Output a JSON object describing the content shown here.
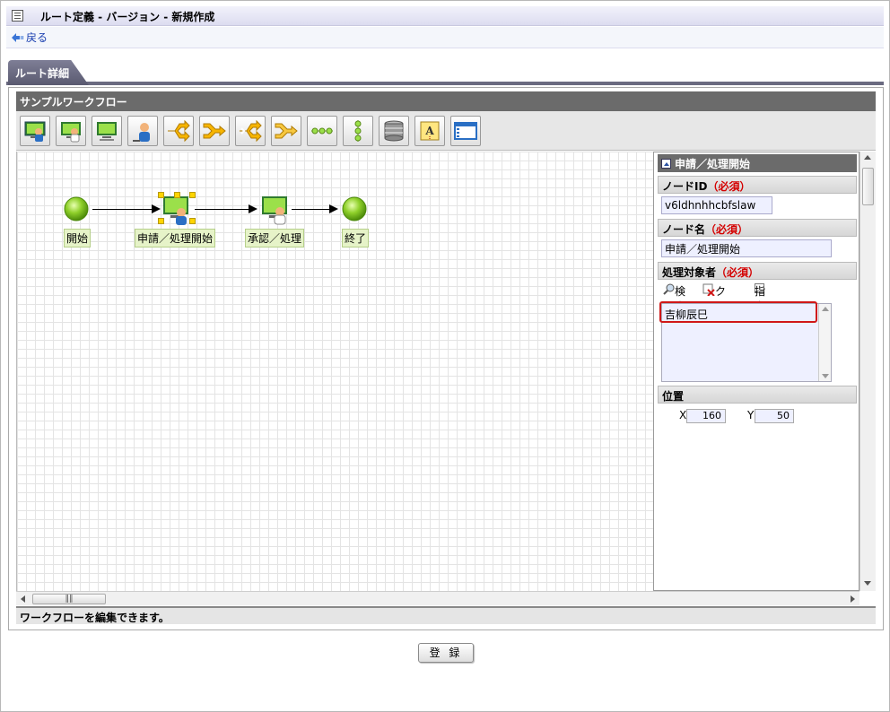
{
  "window": {
    "title": "ルート定義 - バージョン - 新規作成",
    "back_label": "戻る"
  },
  "tab": {
    "label": "ルート詳細"
  },
  "workflow": {
    "name": "サンプルワークフロー",
    "status": "ワークフローを編集できます。",
    "toolbar_icons": [
      "start-node-icon",
      "apply-node-icon",
      "approve-node-icon",
      "user-node-icon",
      "branch-icon",
      "merge-icon",
      "branch-alt-icon",
      "merge-alt-icon",
      "sequence-icon",
      "vertical-sequence-icon",
      "database-icon",
      "text-annotation-icon",
      "window-icon"
    ],
    "nodes": [
      {
        "label": "開始",
        "type": "start"
      },
      {
        "label": "申請／処理開始",
        "type": "apply"
      },
      {
        "label": "承認／処理",
        "type": "approve"
      },
      {
        "label": "終了",
        "type": "end"
      }
    ]
  },
  "properties": {
    "title": "申請／処理開始",
    "node_id_label": "ノードID",
    "node_name_label": "ノード名",
    "target_label": "処理対象者",
    "required_text": "（必須）",
    "node_id_value": "v6ldhnhhcbfslaw",
    "node_name_value": "申請／処理開始",
    "search_label": "検索",
    "clear_label": "クリア",
    "no_spec_label": "指定なし",
    "target_user": "吉柳辰巳",
    "position_label": "位置",
    "x_label": "X",
    "y_label": "Y",
    "x_value": "160",
    "y_value": "50"
  },
  "footer": {
    "register_label": "登 録"
  },
  "colors": {
    "accent_red": "#d40000",
    "header_gray": "#6b6b6b",
    "node_green": "#8fd02a",
    "grid": "#e4e4e4"
  }
}
